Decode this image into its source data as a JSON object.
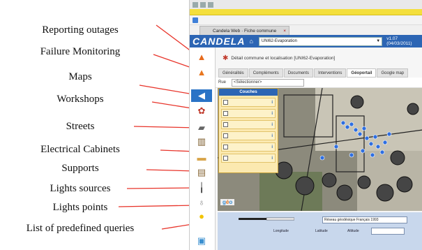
{
  "labels": [
    "Reporting outages",
    "Failure Monitoring",
    "Maps",
    "Workshops",
    "Streets",
    "Electrical Cabinets",
    "Supports",
    "Lights sources",
    "Lights points",
    "List of predefined queries"
  ],
  "app": {
    "tab_title": "Candela Web · Fiche commune",
    "logo": "CANDELA",
    "site_select": "UNI62-Evaporation",
    "version": "v1.07 (04/03/2011)",
    "detail_title": "Détail commune et localisation [UNI62-Evaporation]",
    "subtabs": [
      "Généralités",
      "Compléments",
      "Documents",
      "Interventions",
      "Géoportail",
      "Google map"
    ],
    "rue_label": "Rue",
    "rue_select": "<Sélectionner>",
    "layers_title": "Couches",
    "bottom": {
      "longitude_label": "Longitude",
      "latitude_label": "Latitude",
      "crs": "Réseau géodésique Français 1993",
      "alt_label": "Altitude"
    }
  },
  "colors": {
    "accent": "#2c65b4",
    "connector": "#e8342a",
    "yellow": "#f4df3c"
  }
}
